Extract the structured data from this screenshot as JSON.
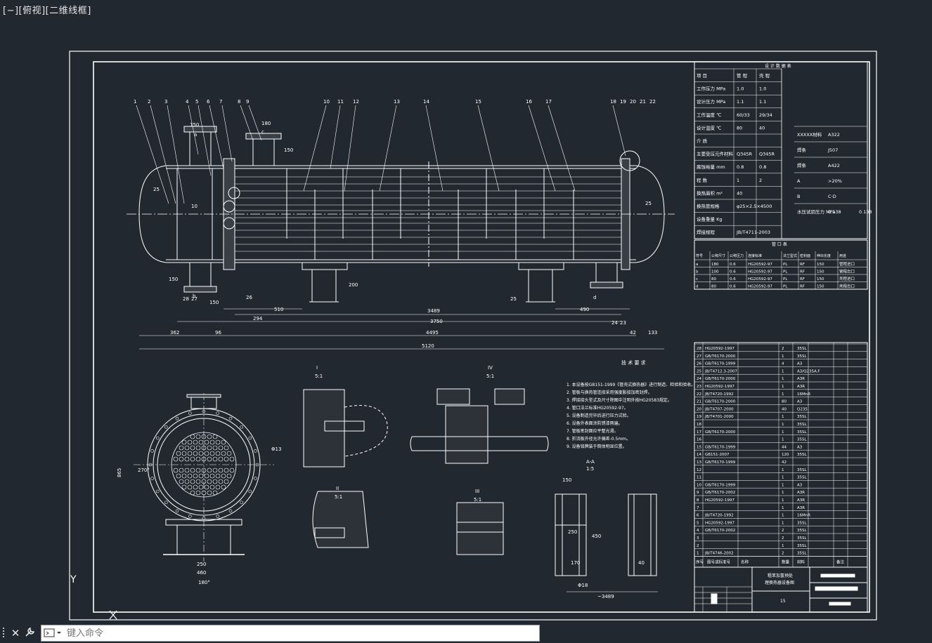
{
  "viewport": {
    "label": "[−][俯视][二维线框]",
    "ucs_axis": "Y",
    "colors": {
      "background": "#212830",
      "lines": "#ffffff",
      "text": "#e6e6e6"
    }
  },
  "drawing": {
    "dimensions": {
      "overall": "5120",
      "body": "4495",
      "tube_length": "3750",
      "baffle_span": "3489",
      "left_offset": "510",
      "right_offset": "490",
      "left_head": "362",
      "left_gap": "96",
      "right_head": "133",
      "right_gap": "42",
      "left_pitch": "294",
      "nozzle_a_w": "150",
      "nozzle_c_w": "180",
      "nozzle_h": "150",
      "support_h": "200",
      "bottom_w": "150",
      "side_25_left": "25",
      "side_25_right": "25",
      "side_10": "10"
    },
    "part_numbers_top": [
      "1",
      "2",
      "3",
      "4",
      "5",
      "6",
      "7",
      "8",
      "9",
      "10",
      "11",
      "12",
      "13",
      "14",
      "15",
      "16",
      "17",
      "18",
      "19",
      "20",
      "21",
      "22"
    ],
    "part_numbers_bottom": [
      "28",
      "27",
      "26",
      "25",
      "24",
      "23"
    ],
    "nozzle_letters": [
      "a",
      "c",
      "b",
      "d"
    ],
    "detail_labels": {
      "section_I": "I",
      "section_II": "II",
      "section_III": "III",
      "section_IV": "IV",
      "scale": "5:1",
      "section_view": "A-A",
      "scale_15": "1:5"
    },
    "end_view": {
      "dim_width": "250",
      "dim_base": "460",
      "dim_height": "865",
      "dia_label": "Φ13",
      "angle": "270°",
      "bottom": "180°"
    },
    "support_view": {
      "w_top": "150",
      "w_mid": "250",
      "h_total": "450",
      "base": "170",
      "hole": "Φ18",
      "base_w": "40",
      "span": "~3489"
    },
    "tech_notes": {
      "title": "技 术 要 求",
      "lines": [
        "1. 本设备按GB151-1999《管壳式换热器》进行制造、检验和验收。",
        "2. 管板与换热管连接采用强度胀接加密封焊。",
        "3. 焊接接头型式及尺寸除图中注明外按HG20583规定。",
        "4. 管口法兰标准HG20592-97。",
        "5. 设备制造完毕后进行压力试验。",
        "6. 设备外表面涂防锈漆两遍。",
        "7. 管板密封面应平整光滑。",
        "8. 折流板外径允许偏差-0.5mm。",
        "9. 设备铭牌装于筒体明显位置。"
      ]
    },
    "design_table": {
      "title": "设 计 数 据 表",
      "rows": [
        [
          "项 目",
          "管 程",
          "壳 程"
        ],
        [
          "工作压力 MPa",
          "1.0",
          "1.0"
        ],
        [
          "设计压力 MPa",
          "1.1",
          "1.1"
        ],
        [
          "工作温度 ℃",
          "60/33",
          "29/34"
        ],
        [
          "设计温度 ℃",
          "80",
          "40"
        ],
        [
          "介 质",
          "",
          ""
        ],
        [
          "主要受压元件材料",
          "Q345R",
          "Q345R"
        ],
        [
          "腐蚀裕量 mm",
          "0.8",
          "0.8"
        ],
        [
          "程 数",
          "1",
          "2"
        ],
        [
          "换热面积 m²",
          "40",
          ""
        ],
        [
          "换热管规格",
          "φ25×2.5×4500",
          ""
        ],
        [
          "设备重量 Kg",
          "",
          ""
        ],
        [
          "焊接规程",
          "JB/T4711-2003",
          ""
        ]
      ],
      "right_rows": [
        [
          "XXXXX材料",
          "A322"
        ],
        [
          "焊条",
          "J507"
        ],
        [
          "焊条",
          "A422"
        ],
        [
          "A",
          ">20%"
        ],
        [
          "B",
          "C·D"
        ],
        [
          "水压试验压力 MPa",
          "0.138",
          "0.138"
        ]
      ]
    },
    "nozzle_table": {
      "title": "管 口 表",
      "headers": [
        "符号",
        "公称尺寸",
        "公称压力",
        "连接标准",
        "法兰型式",
        "密封面",
        "伸出长度",
        "用途"
      ],
      "rows": [
        [
          "a",
          "180",
          "0.6",
          "HG20592-97",
          "PL",
          "RF",
          "150",
          "管程进口"
        ],
        [
          "b",
          "100",
          "0.6",
          "HG20592-97",
          "PL",
          "RF",
          "150",
          "管程出口"
        ],
        [
          "c",
          "80",
          "0.6",
          "HG20592-97",
          "PL",
          "RF",
          "150",
          "壳程进口"
        ],
        [
          "d",
          "80",
          "0.6",
          "HG20592-97",
          "PL",
          "RF",
          "150",
          "壳程出口"
        ]
      ]
    },
    "parts_list": {
      "rows": [
        [
          "28",
          "HG20592-1997",
          "2",
          "35SL"
        ],
        [
          "27",
          "GB/T6170-2000",
          "1",
          "35SL"
        ],
        [
          "26",
          "GB/T6170-1999",
          "4",
          "A3"
        ],
        [
          "25",
          "JB/T4712.3-2007",
          "1",
          "A3/Q235A.F"
        ],
        [
          "24",
          "GB/T6170-2000",
          "1",
          "A3R"
        ],
        [
          "23",
          "HG20592-1997",
          "1",
          "A3R"
        ],
        [
          "22",
          "JB/T4720-1992",
          "1",
          "16MnR"
        ],
        [
          "21",
          "GB/T6170-2000",
          "80",
          "A3"
        ],
        [
          "20",
          "JB/T4707-2000",
          "40",
          "Q235"
        ],
        [
          "19",
          "JB/T4701-2000",
          "1",
          "35SL"
        ],
        [
          "18",
          "",
          "1",
          "35SL"
        ],
        [
          "17",
          "GB/T6170-2000",
          "1",
          "35SL"
        ],
        [
          "16",
          "",
          "1",
          "35SL"
        ],
        [
          "15",
          "GB/T6170-1999",
          "44",
          "A3"
        ],
        [
          "14",
          "GB151-2007",
          "120",
          "35SL"
        ],
        [
          "13",
          "GB/T6170-1999",
          "42",
          ""
        ],
        [
          "12",
          "",
          "1",
          "35SL"
        ],
        [
          "11",
          "",
          "1",
          "35SL"
        ],
        [
          "10",
          "GB/T6170-1999",
          "1",
          "A3"
        ],
        [
          "9",
          "GB/T6170-2002",
          "1",
          "A3R"
        ],
        [
          "8",
          "HG20592-1997",
          "1",
          "A3R"
        ],
        [
          "7",
          "",
          "1",
          "A3R"
        ],
        [
          "6",
          "JB/T4720-1992",
          "1",
          "16MnR"
        ],
        [
          "5",
          "HG20592-1997",
          "1",
          "35SL"
        ],
        [
          "4",
          "GB/T6170-2002",
          "2",
          "35SL"
        ],
        [
          "3",
          "",
          "2",
          "35SL"
        ],
        [
          "2",
          "",
          "1",
          "35SL"
        ],
        [
          "1",
          "JB/T4746-2002",
          "2",
          "35SL"
        ]
      ],
      "footer": [
        "序号",
        "图号或标准号",
        "名称",
        "数量",
        "材料",
        "备注"
      ]
    },
    "title_block": {
      "project_line1": "粗苯加氢预处",
      "project_line2": "理换热器设备图",
      "sheet": "15"
    }
  },
  "cmdbar": {
    "close_icon": "close-icon",
    "settings_icon": "wrench-icon",
    "input_placeholder": "键入命令"
  }
}
